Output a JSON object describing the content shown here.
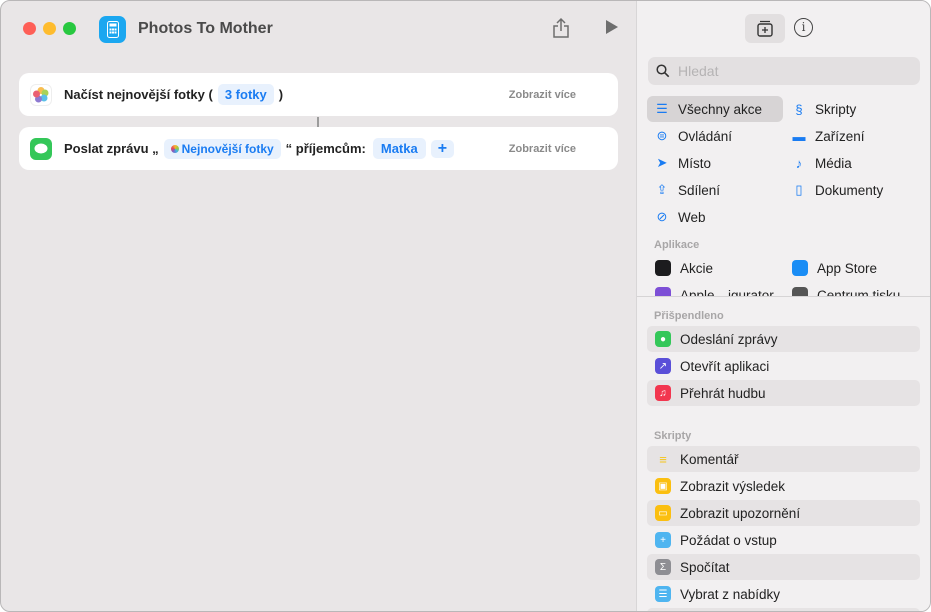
{
  "window": {
    "title": "Photos To Mother"
  },
  "actions": [
    {
      "text": "Načíst nejnovější fotky (",
      "token": "3 fotky",
      "suffix": ")",
      "more": "Zobrazit více"
    },
    {
      "text": "Poslat zprávu „",
      "token": "Nejnovější fotky",
      "middle": "“ příjemcům:",
      "recipient": "Matka",
      "add": "+",
      "more": "Zobrazit více"
    }
  ],
  "sidebar": {
    "search_placeholder": "Hledat",
    "info": "i",
    "categories": [
      "Všechny akce",
      "Skripty",
      "Ovládání",
      "Zařízení",
      "Místo",
      "Média",
      "Sdílení",
      "Dokumenty",
      "Web"
    ],
    "apps_header": "Aplikace",
    "apps": [
      "Akcie",
      "App Store",
      "Apple…igurator",
      "Centrum tisku"
    ],
    "pinned_header": "Přišpendleno",
    "pinned": [
      "Odeslání zprávy",
      "Otevřít aplikaci",
      "Přehrát hudbu"
    ],
    "scripts_header": "Skripty",
    "scripts": [
      "Komentář",
      "Zobrazit výsledek",
      "Zobrazit upozornění",
      "Požádat o vstup",
      "Spočítat",
      "Vybrat z nabídky"
    ]
  },
  "colors": {
    "accent": "#1a7cf2",
    "close": "#fe5f57",
    "minimize": "#febc2e",
    "zoom": "#28c840"
  }
}
